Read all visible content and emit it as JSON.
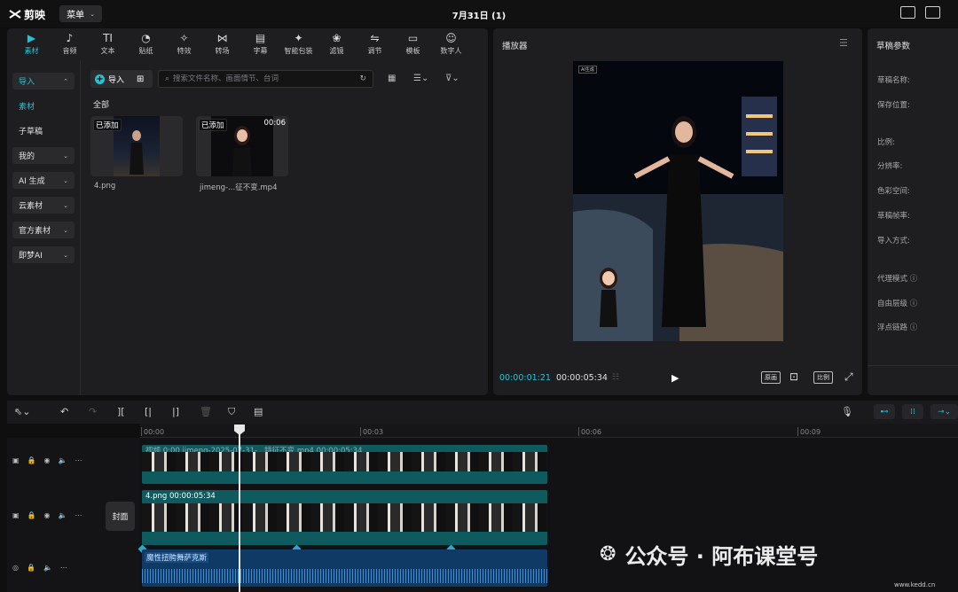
{
  "app": {
    "logo": "剪映",
    "menu_label": "菜单",
    "project_title": "7月31日 (1)"
  },
  "tabs": [
    {
      "label": "素材",
      "icon": "▶",
      "active": true
    },
    {
      "label": "音频",
      "icon": "♪"
    },
    {
      "label": "文本",
      "icon": "TI"
    },
    {
      "label": "贴纸",
      "icon": "◔"
    },
    {
      "label": "特效",
      "icon": "✧"
    },
    {
      "label": "转场",
      "icon": "⋈"
    },
    {
      "label": "字幕",
      "icon": "▤"
    },
    {
      "label": "智能包装",
      "icon": "✦"
    },
    {
      "label": "滤镜",
      "icon": "❀"
    },
    {
      "label": "调节",
      "icon": "⇋"
    },
    {
      "label": "模板",
      "icon": "▭"
    },
    {
      "label": "数字人",
      "icon": "☺"
    }
  ],
  "sidebar": [
    {
      "label": "导入",
      "chevron": "⌃",
      "style": "cyan"
    },
    {
      "label": "素材",
      "style": "cyan plain"
    },
    {
      "label": "子草稿",
      "style": "plain"
    },
    {
      "label": "我的",
      "chevron": "⌄"
    },
    {
      "label": "AI 生成",
      "chevron": "⌄"
    },
    {
      "label": "云素材",
      "chevron": "⌄"
    },
    {
      "label": "官方素材",
      "chevron": "⌄"
    },
    {
      "label": "即梦AI",
      "chevron": "⌄"
    }
  ],
  "media": {
    "import_label": "导入",
    "search_placeholder": "搜索文件名称、画面情节、台词",
    "all_label": "全部",
    "items": [
      {
        "badge": "已添加",
        "duration": "",
        "name": "4.png"
      },
      {
        "badge": "已添加",
        "duration": "00:06",
        "name": "jimeng-...征不变.mp4"
      }
    ]
  },
  "player": {
    "title": "播放器",
    "current_time": "00:00:01:21",
    "total_time": "00:00:05:34",
    "btn_original": "原画",
    "btn_ratio": "比例",
    "ai_tag": "AI生成"
  },
  "draft": {
    "title": "草稿参数",
    "labels": [
      "草稿名称:",
      "保存位置:",
      "比例:",
      "分辨率:",
      "色彩空间:",
      "草稿帧率:",
      "导入方式:",
      "代理模式 ⓘ",
      "自由层级 ⓘ",
      "浮点链路 ⓘ"
    ]
  },
  "timeline": {
    "ticks": [
      "00:00",
      "00:03",
      "00:06",
      "00:09"
    ],
    "cover_label": "封面",
    "clip1_label": "视频 0:00 jimeng-2025-07-31-...特征不变.mp4  00:00:05:34",
    "clip2_label": "4.png  00:00:05:34",
    "audio_label": "魔性扭胯舞萨克斯"
  },
  "watermark": {
    "text": "公众号 · 阿布课堂号",
    "url": "www.kedd.cn"
  },
  "colors": {
    "accent": "#1fc4d6",
    "panel": "#1e1e20",
    "clip": "#0f5a5f",
    "audio": "#0f3a66"
  }
}
